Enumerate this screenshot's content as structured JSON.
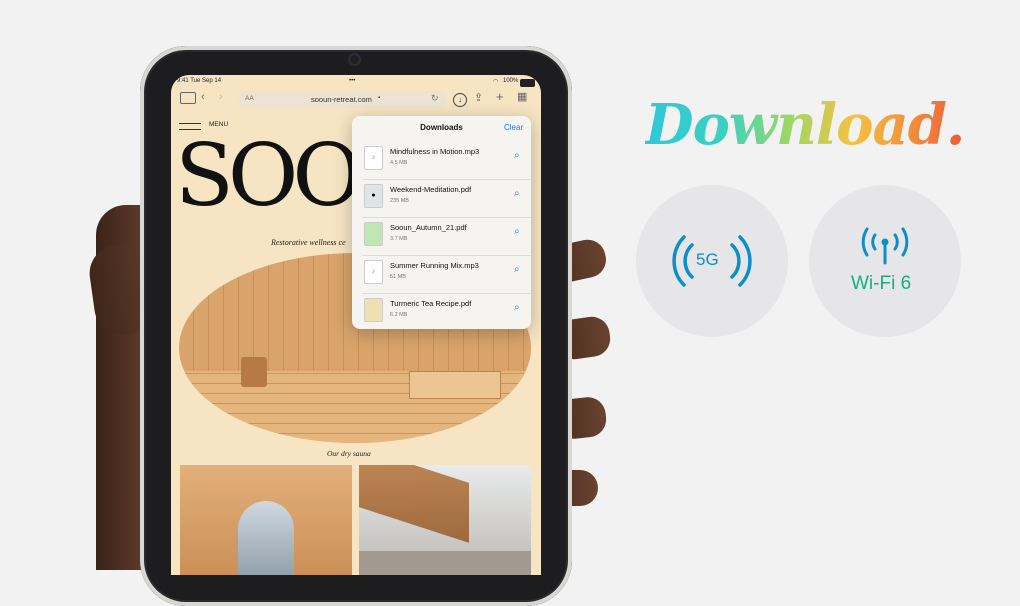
{
  "status_bar": {
    "time": "9:41 Tue Sep 14",
    "dots": "•••",
    "battery": "100%"
  },
  "browser": {
    "url": "sooun-retreat.com",
    "text_size": "AA",
    "lock": "🔒"
  },
  "site": {
    "menu_label": "MENU",
    "logo_text": "SOO",
    "tagline": "Restorative wellness ce",
    "caption": "Our dry sauna"
  },
  "downloads": {
    "title": "Downloads",
    "clear": "Clear",
    "items": [
      {
        "name": "Mindfulness in Motion.mp3",
        "size": "4.5 MB",
        "icon": "audio-file-icon"
      },
      {
        "name": "Weekend-Meditation.pdf",
        "size": "235 MB",
        "icon": "pdf-file-icon"
      },
      {
        "name": "Sooun_Autumn_21.pdf",
        "size": "3.7 MB",
        "icon": "pdf-file-icon"
      },
      {
        "name": "Summer Running Mix.mp3",
        "size": "51 MB",
        "icon": "audio-file-icon"
      },
      {
        "name": "Turmeric Tea Recipe.pdf",
        "size": "6.2 MB",
        "icon": "pdf-file-icon"
      }
    ]
  },
  "promo": {
    "headline": "Download.",
    "badge_5g": "5G",
    "badge_wifi": "Wi-Fi 6"
  },
  "colors": {
    "accent_blue": "#1a7cf5",
    "fiveg_blue": "#0d8ec8",
    "wifi_green": "#13b07d"
  }
}
